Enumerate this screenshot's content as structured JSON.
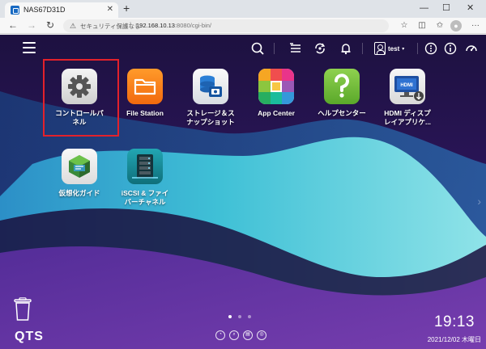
{
  "browser": {
    "tab_title": "NAS67D31D",
    "tab_close": "✕",
    "new_tab": "+",
    "win_min": "—",
    "win_max": "☐",
    "win_close": "✕",
    "nav_back": "←",
    "nav_forward": "→",
    "nav_reload": "↻",
    "security_warning": "セキュリティ保護なし",
    "url_separator": "|",
    "url_host": "192.168.10.13",
    "url_path": ":8080/cgi-bin/",
    "icons": [
      "star-icon",
      "split-screen-icon",
      "favorites-icon",
      "profile-icon",
      "more-icon"
    ],
    "more": "···"
  },
  "qts": {
    "topbar_icons": [
      "search-icon",
      "background-tasks-icon",
      "sync-icon",
      "notification-icon",
      "user-icon",
      "options-icon",
      "info-icon",
      "resource-monitor-icon"
    ],
    "user_name": "test",
    "user_caret": "▾",
    "apps": [
      {
        "label": "コントロールパ\nネル",
        "icon": "gear-icon"
      },
      {
        "label": "File Station",
        "icon": "folder-icon"
      },
      {
        "label": "ストレージ＆ス\nナップショット",
        "icon": "storage-icon"
      },
      {
        "label": "App Center",
        "icon": "app-grid-icon"
      },
      {
        "label": "ヘルプセンター",
        "icon": "help-icon"
      },
      {
        "label": "HDMI ディスプ\nレイアプリケ...",
        "icon": "hdmi-monitor-icon"
      },
      {
        "label": "仮想化ガイド",
        "icon": "virtualization-icon"
      },
      {
        "label": "iSCSI & ファイ\nバーチャネル",
        "icon": "iscsi-icon"
      }
    ],
    "logo": "QTS",
    "page_dots": 3,
    "active_page": 0,
    "dock_icons": [
      "dashboard-icon",
      "search-dock-icon",
      "storage-dock-icon",
      "network-dock-icon"
    ],
    "clock_time": "19:13",
    "clock_date": "2021/12/02 木曜日",
    "side_arrow": "›"
  }
}
